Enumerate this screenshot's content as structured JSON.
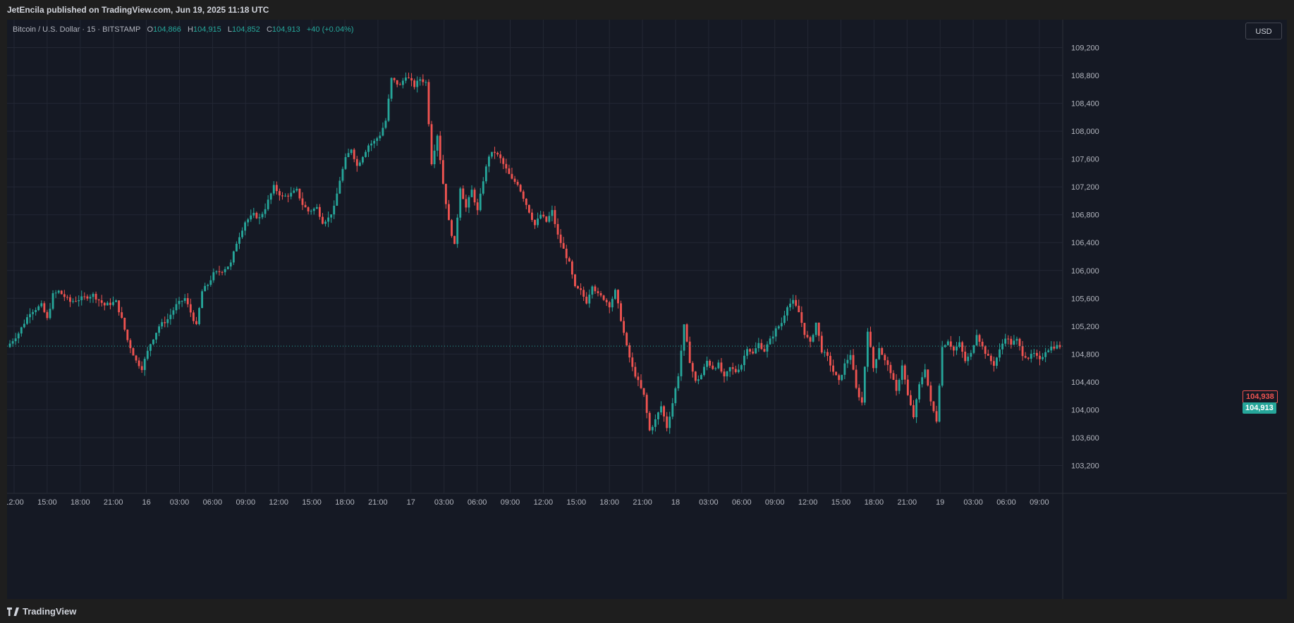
{
  "header": {
    "published_text": "JetEncila published on TradingView.com, Jun 19, 2025 11:18 UTC"
  },
  "legend": {
    "symbol": "Bitcoin / U.S. Dollar · 15 · BITSTAMP",
    "open_label": "O",
    "open_value": "104,866",
    "high_label": "H",
    "high_value": "104,915",
    "low_label": "L",
    "low_value": "104,852",
    "close_label": "C",
    "close_value": "104,913",
    "change": "+40 (+0.04%)"
  },
  "currency_button": "USD",
  "price_tags": {
    "last_high": "104,938",
    "current": "104,913"
  },
  "footer": {
    "brand": "TradingView"
  },
  "colors": {
    "up": "#26a69a",
    "down": "#ef5350",
    "background": "#151924",
    "grid": "#232734",
    "text": "#b2b5be"
  },
  "chart_data": {
    "type": "candlestick",
    "title": "Bitcoin / U.S. Dollar · 15 · BITSTAMP",
    "y_ticks": [
      103200,
      103600,
      104000,
      104400,
      104800,
      105200,
      105600,
      106000,
      106400,
      106800,
      107200,
      107600,
      108000,
      108400,
      108800,
      109200
    ],
    "y_tick_labels": [
      "103,200",
      "103,600",
      "104,000",
      "104,400",
      "104,800",
      "105,200",
      "105,600",
      "106,000",
      "106,400",
      "106,800",
      "107,200",
      "107,600",
      "108,000",
      "108,400",
      "108,800",
      "109,200"
    ],
    "ylim": [
      102800,
      109600
    ],
    "x_tick_labels": [
      "12:00",
      "15:00",
      "18:00",
      "21:00",
      "16",
      "03:00",
      "06:00",
      "09:00",
      "12:00",
      "15:00",
      "18:00",
      "21:00",
      "17",
      "03:00",
      "06:00",
      "09:00",
      "12:00",
      "15:00",
      "18:00",
      "21:00",
      "18",
      "03:00",
      "06:00",
      "09:00",
      "12:00",
      "15:00",
      "18:00",
      "21:00",
      "19",
      "03:00",
      "06:00",
      "09:00"
    ],
    "current_price": 104913,
    "price_path": [
      [
        0,
        104900
      ],
      [
        4,
        105100
      ],
      [
        8,
        105400
      ],
      [
        12,
        105500
      ],
      [
        14,
        105300
      ],
      [
        16,
        105650
      ],
      [
        18,
        105700
      ],
      [
        22,
        105550
      ],
      [
        26,
        105600
      ],
      [
        30,
        105650
      ],
      [
        34,
        105500
      ],
      [
        38,
        105550
      ],
      [
        40,
        105300
      ],
      [
        42,
        105000
      ],
      [
        45,
        104700
      ],
      [
        47,
        104600
      ],
      [
        50,
        104950
      ],
      [
        53,
        105200
      ],
      [
        56,
        105300
      ],
      [
        59,
        105500
      ],
      [
        62,
        105600
      ],
      [
        64,
        105400
      ],
      [
        66,
        105200
      ],
      [
        68,
        105700
      ],
      [
        70,
        105800
      ],
      [
        72,
        105950
      ],
      [
        75,
        106000
      ],
      [
        78,
        106100
      ],
      [
        80,
        106400
      ],
      [
        83,
        106700
      ],
      [
        86,
        106800
      ],
      [
        88,
        106750
      ],
      [
        90,
        106900
      ],
      [
        93,
        107200
      ],
      [
        96,
        107050
      ],
      [
        99,
        107100
      ],
      [
        101,
        107150
      ],
      [
        103,
        106950
      ],
      [
        105,
        106850
      ],
      [
        108,
        106900
      ],
      [
        110,
        106700
      ],
      [
        112,
        106750
      ],
      [
        114,
        106900
      ],
      [
        116,
        107300
      ],
      [
        118,
        107600
      ],
      [
        120,
        107750
      ],
      [
        122,
        107500
      ],
      [
        124,
        107650
      ],
      [
        126,
        107800
      ],
      [
        128,
        107850
      ],
      [
        130,
        107950
      ],
      [
        132,
        108150
      ],
      [
        134,
        108750
      ],
      [
        137,
        108650
      ],
      [
        139,
        108800
      ],
      [
        142,
        108650
      ],
      [
        144,
        108750
      ],
      [
        146,
        108700
      ],
      [
        148,
        107550
      ],
      [
        150,
        107950
      ],
      [
        152,
        107250
      ],
      [
        154,
        106700
      ],
      [
        156,
        106350
      ],
      [
        158,
        107200
      ],
      [
        160,
        106900
      ],
      [
        162,
        107150
      ],
      [
        164,
        106850
      ],
      [
        166,
        107300
      ],
      [
        168,
        107650
      ],
      [
        170,
        107700
      ],
      [
        172,
        107600
      ],
      [
        174,
        107450
      ],
      [
        176,
        107300
      ],
      [
        178,
        107250
      ],
      [
        180,
        107050
      ],
      [
        182,
        106850
      ],
      [
        184,
        106650
      ],
      [
        186,
        106800
      ],
      [
        188,
        106700
      ],
      [
        190,
        106850
      ],
      [
        192,
        106500
      ],
      [
        194,
        106300
      ],
      [
        196,
        106100
      ],
      [
        198,
        105750
      ],
      [
        200,
        105700
      ],
      [
        202,
        105550
      ],
      [
        204,
        105800
      ],
      [
        206,
        105650
      ],
      [
        208,
        105600
      ],
      [
        210,
        105500
      ],
      [
        212,
        105700
      ],
      [
        214,
        105300
      ],
      [
        216,
        104900
      ],
      [
        218,
        104600
      ],
      [
        220,
        104400
      ],
      [
        222,
        104200
      ],
      [
        224,
        103700
      ],
      [
        226,
        103850
      ],
      [
        228,
        104050
      ],
      [
        230,
        103750
      ],
      [
        232,
        104100
      ],
      [
        234,
        104500
      ],
      [
        236,
        105200
      ],
      [
        238,
        104700
      ],
      [
        240,
        104400
      ],
      [
        242,
        104500
      ],
      [
        244,
        104700
      ],
      [
        246,
        104600
      ],
      [
        248,
        104650
      ],
      [
        250,
        104450
      ],
      [
        252,
        104600
      ],
      [
        254,
        104550
      ],
      [
        256,
        104650
      ],
      [
        258,
        104900
      ],
      [
        260,
        104800
      ],
      [
        262,
        104950
      ],
      [
        264,
        104850
      ],
      [
        266,
        105000
      ],
      [
        268,
        105150
      ],
      [
        270,
        105250
      ],
      [
        272,
        105500
      ],
      [
        274,
        105550
      ],
      [
        276,
        105400
      ],
      [
        278,
        105100
      ],
      [
        280,
        104950
      ],
      [
        282,
        105250
      ],
      [
        284,
        104850
      ],
      [
        286,
        104750
      ],
      [
        288,
        104550
      ],
      [
        290,
        104400
      ],
      [
        292,
        104650
      ],
      [
        294,
        104800
      ],
      [
        296,
        104300
      ],
      [
        298,
        104100
      ],
      [
        300,
        105150
      ],
      [
        302,
        104600
      ],
      [
        304,
        104900
      ],
      [
        306,
        104700
      ],
      [
        308,
        104550
      ],
      [
        310,
        104250
      ],
      [
        312,
        104650
      ],
      [
        314,
        104200
      ],
      [
        316,
        103900
      ],
      [
        318,
        104350
      ],
      [
        320,
        104600
      ],
      [
        322,
        104100
      ],
      [
        324,
        103850
      ],
      [
        326,
        104900
      ],
      [
        328,
        105000
      ],
      [
        330,
        104850
      ],
      [
        332,
        104950
      ],
      [
        334,
        104700
      ],
      [
        336,
        104800
      ],
      [
        338,
        105100
      ],
      [
        340,
        104900
      ],
      [
        342,
        104750
      ],
      [
        344,
        104650
      ],
      [
        346,
        104850
      ],
      [
        348,
        105050
      ],
      [
        350,
        104950
      ],
      [
        352,
        105000
      ],
      [
        354,
        104800
      ],
      [
        356,
        104750
      ],
      [
        358,
        104800
      ],
      [
        360,
        104700
      ],
      [
        362,
        104850
      ],
      [
        364,
        104900
      ],
      [
        366,
        104913
      ]
    ],
    "n_candles": 367
  }
}
